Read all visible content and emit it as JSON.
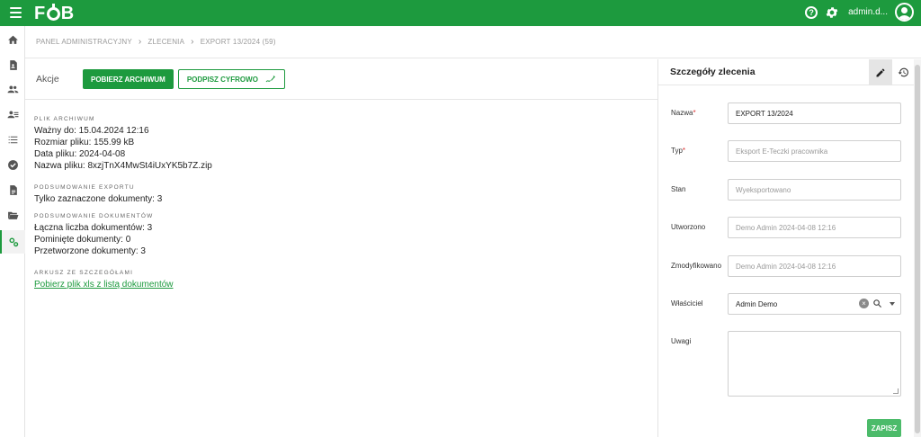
{
  "app": {
    "logo": "FOB"
  },
  "topbar": {
    "user_name": "admin.d..."
  },
  "breadcrumb": [
    "PANEL ADMINISTRACYJNY",
    "ZLECENIA",
    "EXPORT 13/2024 (59)"
  ],
  "actions": {
    "label": "Akcje",
    "download_archive": "POBIERZ ARCHIWUM",
    "sign_digitally": "PODPISZ CYFROWO"
  },
  "archive": {
    "title": "PLIK ARCHIWUM",
    "valid_until": "Ważny do: 15.04.2024 12:16",
    "file_size": "Rozmiar pliku: 155.99 kB",
    "file_date": "Data pliku: 2024-04-08",
    "file_name": "Nazwa pliku: 8xzjTnX4MwSt4iUxYK5b7Z.zip"
  },
  "export_summary": {
    "title": "PODSUMOWANIE EXPORTU",
    "only_selected": "Tylko zaznaczone dokumenty: 3"
  },
  "docs_summary": {
    "title": "PODSUMOWANIE DOKUMENTÓW",
    "total": "Łączna liczba dokumentów: 3",
    "skipped": "Pominięte dokumenty: 0",
    "processed": "Przetworzone dokumenty: 3"
  },
  "sheet": {
    "title": "ARKUSZ ZE SZCZEGÓŁAMI",
    "link": "Pobierz plik xls z listą dokumentów"
  },
  "details_panel": {
    "title": "Szczegóły zlecenia",
    "fields": {
      "name_label": "Nazwa",
      "name_value": "EXPORT 13/2024",
      "type_label": "Typ",
      "type_value": "Eksport E-Teczki pracownika",
      "state_label": "Stan",
      "state_value": "Wyeksportowano",
      "created_label": "Utworzono",
      "created_value": "Demo Admin 2024-04-08 12:16",
      "modified_label": "Zmodyfikowano",
      "modified_value": "Demo Admin 2024-04-08 12:16",
      "owner_label": "Właściciel",
      "owner_value": "Admin Demo",
      "notes_label": "Uwagi"
    },
    "save": "ZAPISZ"
  },
  "colors": {
    "brand": "#1d9a3e",
    "save": "#4cbb6a"
  }
}
